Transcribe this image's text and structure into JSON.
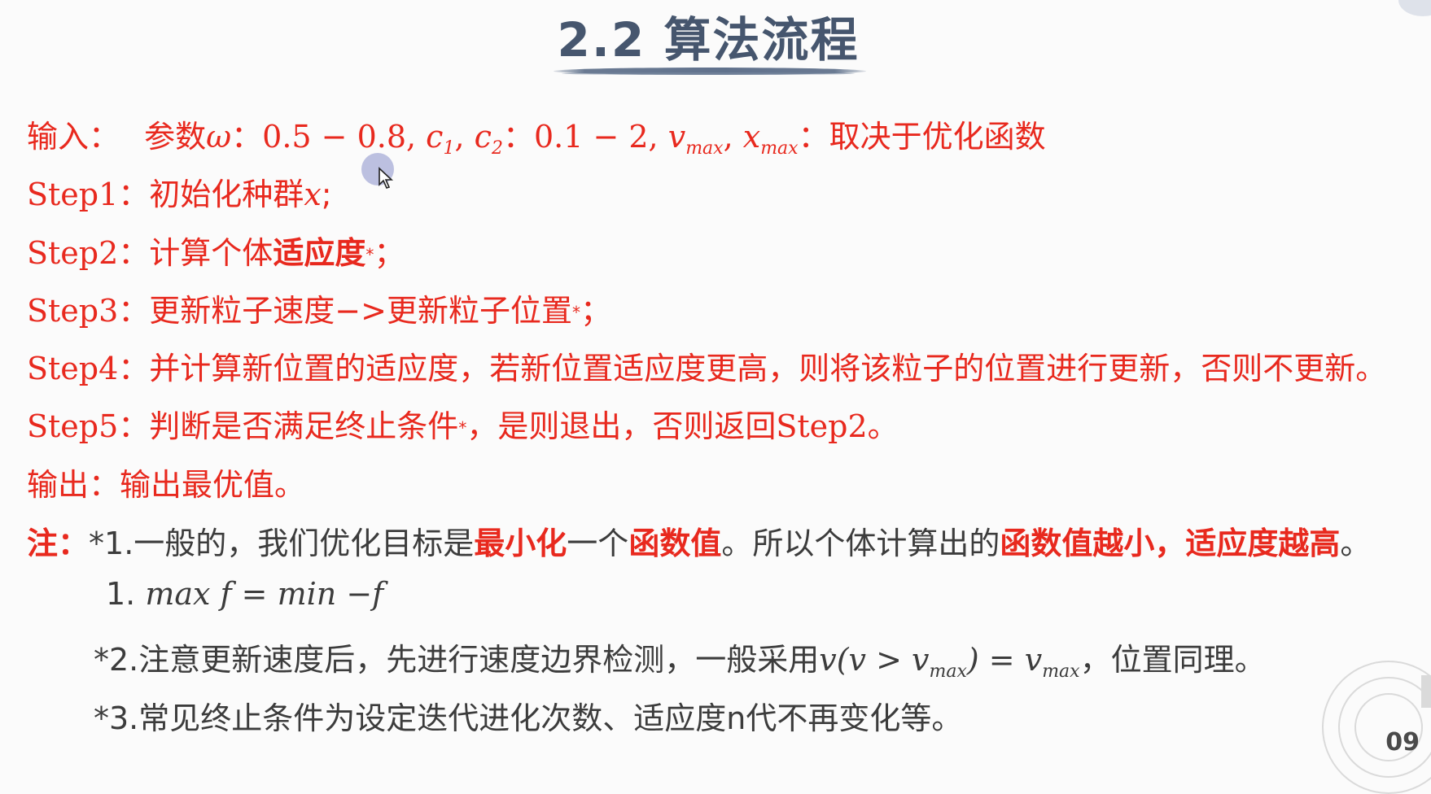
{
  "title": "2.2 算法流程",
  "input": {
    "label": "输入：",
    "params_prefix": "参数",
    "omega": "ω",
    "colon1": "：",
    "omega_range": "0.5 − 0.8, ",
    "c": "c",
    "c1_sub": "1",
    "comma": ", ",
    "c2_sub": "2",
    "colon2": "：",
    "c_range": "0.1 − 2, ",
    "v": "v",
    "max_sub": "max",
    "x": "x",
    "tail": "：取决于优化函数"
  },
  "steps": {
    "s1": {
      "label": "Step1：",
      "text": "初始化种群",
      "var": "x",
      "end": ";"
    },
    "s2": {
      "label": "Step2：",
      "text": "计算个体",
      "bold": "适应度",
      "star": "*",
      "end": "；"
    },
    "s3": {
      "label": "Step3：",
      "text": "更新粒子速度−>更新粒子位置",
      "star": "*",
      "end": "；"
    },
    "s4": {
      "label": "Step4：",
      "text": "并计算新位置的适应度，若新位置适应度更高，则将该粒子的位置进行更新，否则不更新。"
    },
    "s5": {
      "label": "Step5：",
      "text": "判断是否满足终止条件",
      "star": "*",
      "tail": "，是则退出，否则返回",
      "ref": "Step2",
      "end": "。"
    }
  },
  "output": {
    "label": "输出：",
    "text": "输出最优值。"
  },
  "note": {
    "label": "注：",
    "n1_a": "*1.一般的，我们优化目标是",
    "n1_b": "最小化",
    "n1_c": "一个",
    "n1_d": "函数值",
    "n1_e": "。所以个体计算出的",
    "n1_f": "函数值越小，适应度越高",
    "n1_g": "。",
    "n1_formula_num": "1. ",
    "n1_formula": "max f = min −f",
    "n2_a": "*2.注意更新速度后，先进行速度边界检测，一般采用",
    "n2_formula_a": "v(v > v",
    "n2_max": "max",
    "n2_formula_b": ") = v",
    "n2_b": "，位置同理。",
    "n3": "*3.常见终止条件为设定迭代进化次数、适应度n代不再变化等。"
  },
  "page_number": "09"
}
